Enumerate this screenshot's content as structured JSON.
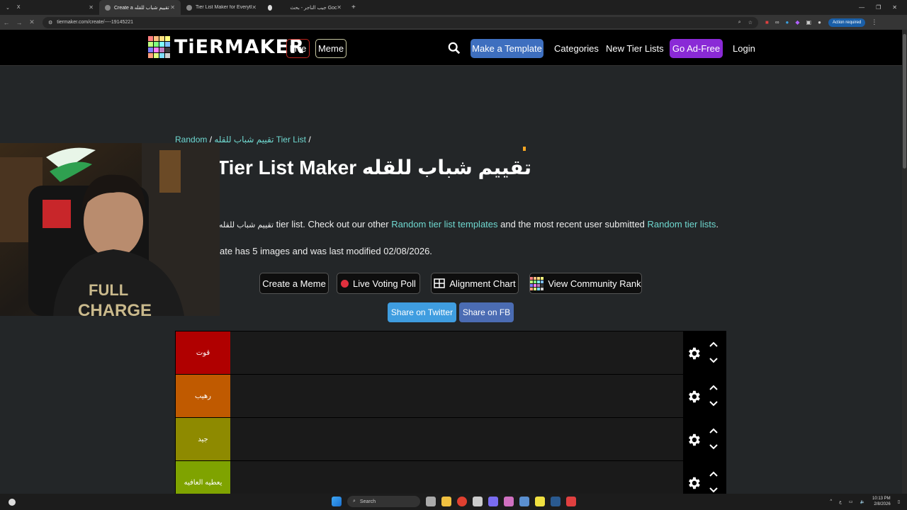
{
  "browser": {
    "tabs": [
      {
        "label": "X",
        "active": false
      },
      {
        "label": "Create a تقييم شباب للقله Tier Li...",
        "active": true
      },
      {
        "label": "Tier List Maker for Everything -...",
        "active": false
      },
      {
        "label": "جيب الناجر - بحث Google",
        "active": false
      }
    ],
    "new_tab": "+",
    "url": "tiermaker.com/create/----19145221",
    "action_required": "Action required"
  },
  "header": {
    "logo_text": "TiERMAKER",
    "logo_colors": [
      "#ff7f7f",
      "#ffbf7f",
      "#ffdf7f",
      "#ffff7f",
      "#bfff7f",
      "#7fff7f",
      "#7fffff",
      "#7fbfff",
      "#7f7fff",
      "#ff7fff",
      "#bf7fbf",
      "#3b3b3b",
      "#ff9f7f",
      "#dfff7f",
      "#7fdfff",
      "#cfcfcf"
    ],
    "live": "Live",
    "meme": "Meme",
    "make_template": "Make a Template",
    "categories": "Categories",
    "new_tier_lists": "New Tier Lists",
    "go_ad_free": "Go Ad-Free",
    "login": "Login"
  },
  "breadcrumb": {
    "category": "Random",
    "sep1": " / ",
    "current": "تقييم شباب للقله Tier List",
    "sep2": " /"
  },
  "title": "تقييم شباب للقله Tier List Maker",
  "description": {
    "prefix": "تقييم شباب للقله",
    "part1": " tier list. Check out our other ",
    "link1": "Random tier list templates",
    "part2": " and the most recent user submitted ",
    "link2": "Random tier lists",
    "part3": "."
  },
  "meta_text": "ate has 5 images and was last modified 02/08/2026.",
  "tools": {
    "create_meme": "Create a Meme",
    "live_voting": "Live Voting Poll",
    "alignment": "Alignment Chart",
    "community_rank": "View Community Rank"
  },
  "share": {
    "twitter": "Share on Twitter",
    "facebook": "Share on FB"
  },
  "tiers": [
    {
      "label": "قوت",
      "color": "#b00000"
    },
    {
      "label": "رهيب",
      "color": "#c05a00"
    },
    {
      "label": "جيد",
      "color": "#8e8a00"
    },
    {
      "label": "يعطيه العافيه",
      "color": "#7fa300"
    }
  ],
  "taskbar": {
    "search": "Search",
    "time": "10:13 PM",
    "date": "2/8/2026"
  }
}
